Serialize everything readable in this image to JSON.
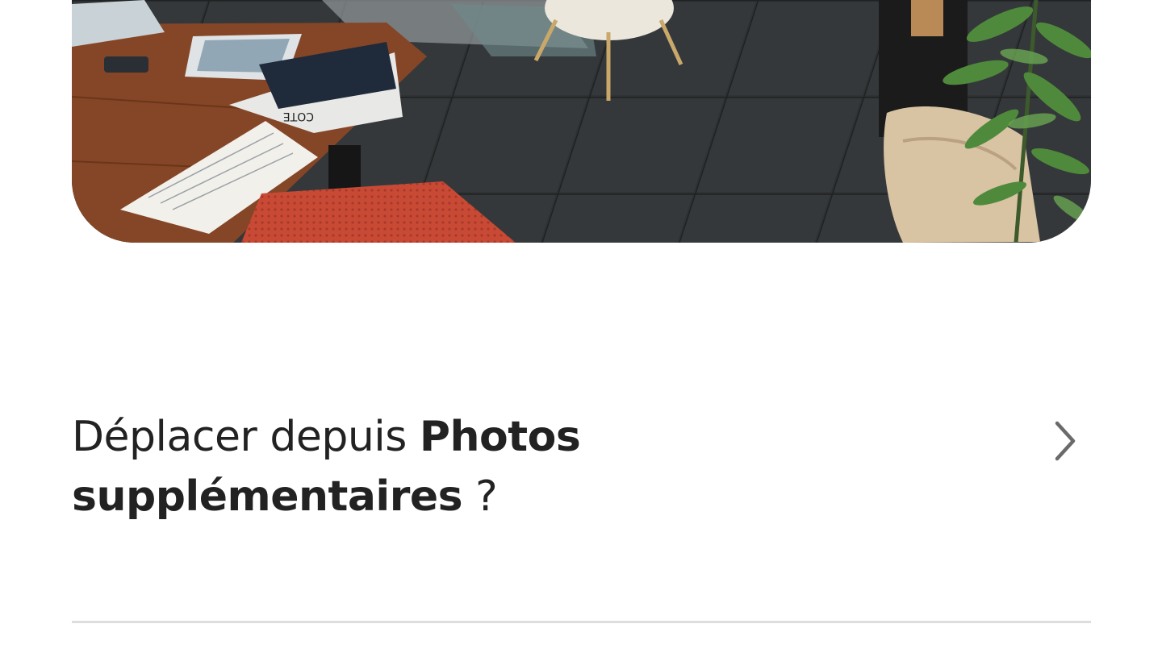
{
  "photo": {
    "icon": "listing-photo",
    "sign_text": "COTE"
  },
  "move_prompt": {
    "prefix": "Déplacer depuis ",
    "section": "Photos",
    "section_cont": "supplémentaires",
    "suffix": " ?",
    "chevron_icon": "chevron-right-icon"
  },
  "colors": {
    "text": "#222222",
    "divider": "#dddddd",
    "chevron": "#6a6a6a"
  }
}
